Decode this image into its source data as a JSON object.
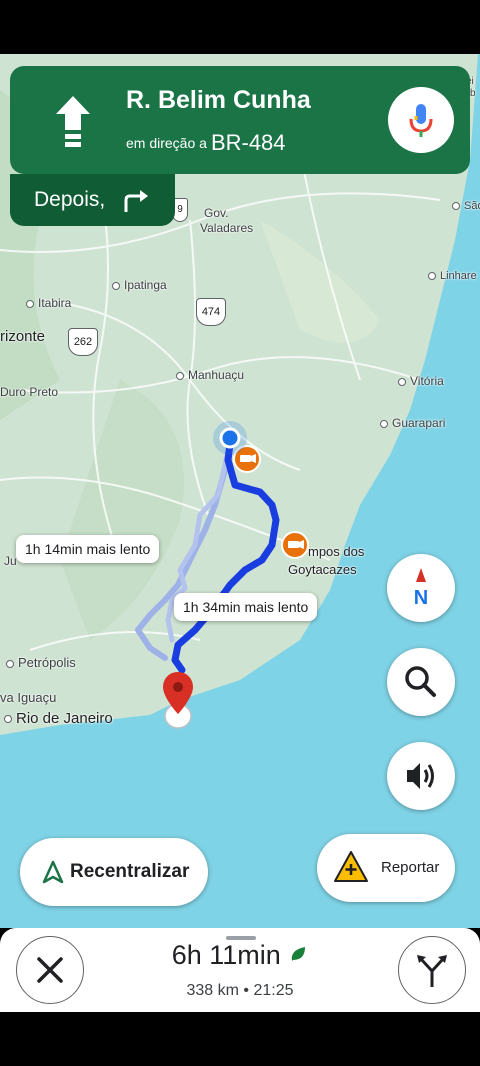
{
  "navigation": {
    "street": "R. Belim Cunha",
    "toward_prefix": "em direção a",
    "toward_road": "BR-484",
    "then_label": "Depois,",
    "maneuver_icon": "straight-arrow-icon",
    "then_icon": "turn-right-arrow-icon",
    "mic_icon": "mic-icon"
  },
  "map": {
    "places": {
      "gov": "Gov.",
      "valadares": "Valadares",
      "ipatinga": "Ipatinga",
      "itabira": "Itabira",
      "horizonte": "rizonte",
      "ouro_preto": "Duro Preto",
      "manhuacu": "Manhuaçu",
      "vitoria": "Vitória",
      "guarapari": "Guarapari",
      "campos_1": "mpos dos",
      "campos_2": "Goytacazes",
      "petropolis": "Petrópolis",
      "nova_iguacu": "va Iguaçu",
      "rio": "Rio de Janeiro",
      "juiz": "Ju",
      "sao": "São",
      "linhares": "Linhare",
      "corner_1": "ei",
      "corner_2": "b"
    },
    "shields": [
      "474",
      "262",
      "9"
    ],
    "alternatives": [
      {
        "label": "1h 14min mais lento"
      },
      {
        "label": "1h 34min mais lento"
      }
    ],
    "colors": {
      "route": "#1a3de0",
      "alt_route": "#9fb2e8",
      "nav_green": "#1a7446",
      "pin": "#d93025",
      "camera": "#e8710a"
    }
  },
  "controls": {
    "compass_label": "N",
    "recenter_label": "Recentralizar",
    "report_label": "Reportar"
  },
  "trip": {
    "hours": "6h",
    "minutes": "11",
    "min_unit": "min",
    "distance": "338 km",
    "separator": "•",
    "arrival": "21:25"
  }
}
